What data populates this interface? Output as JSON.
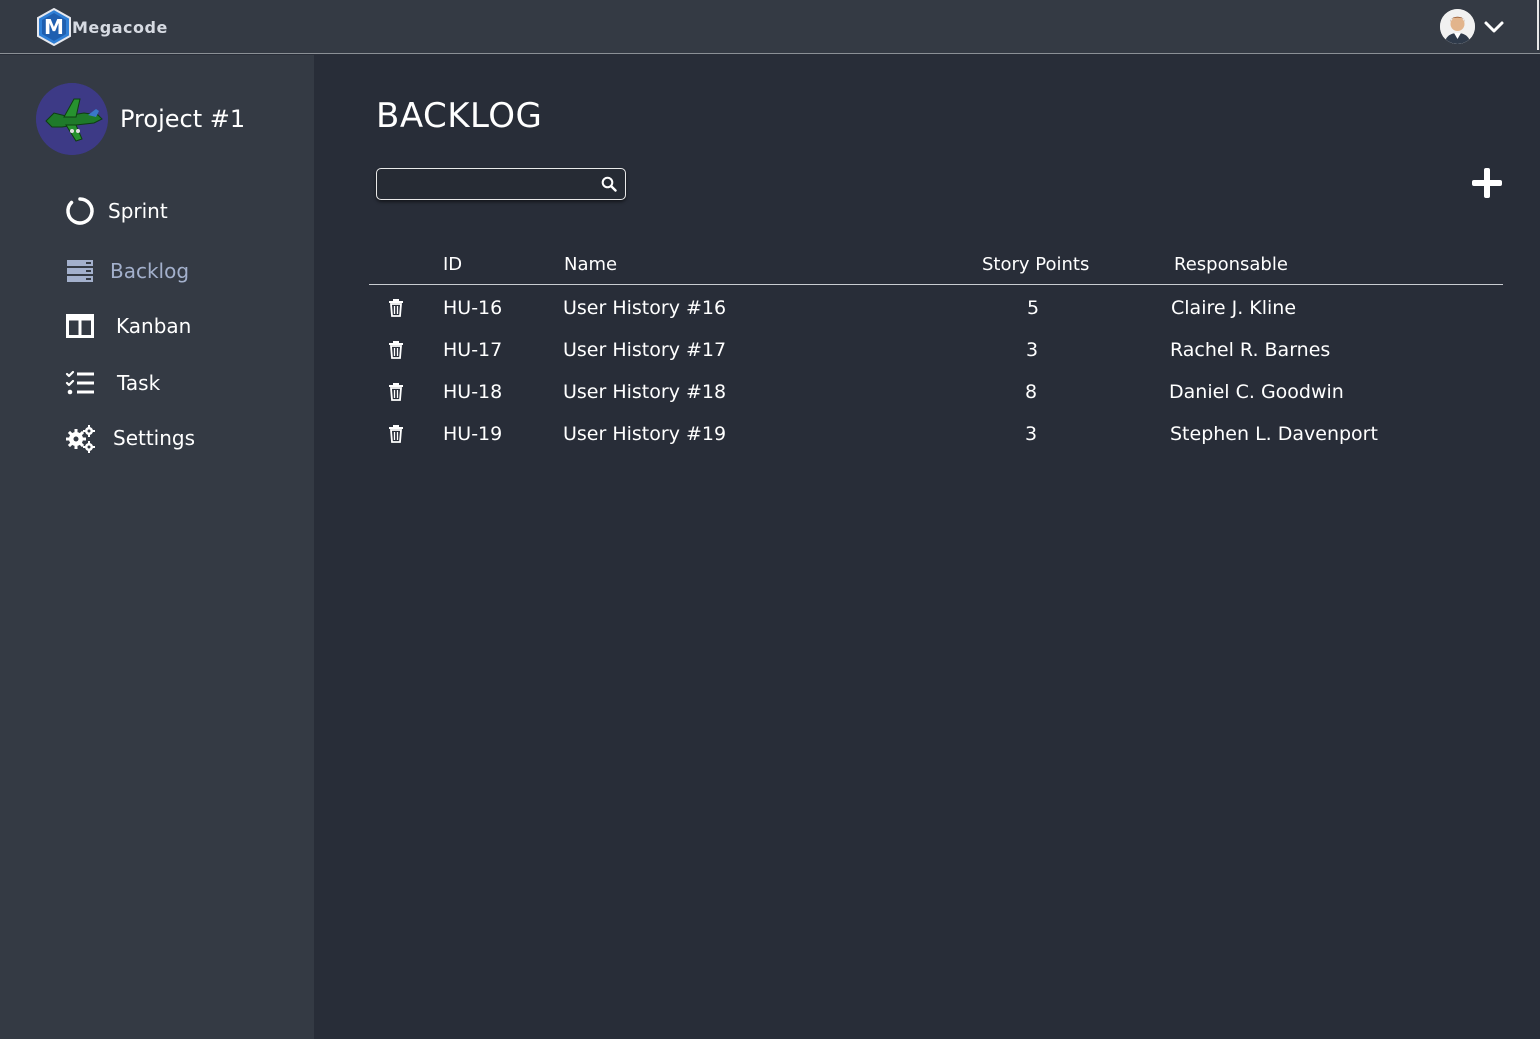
{
  "app": {
    "brand": "Megacode",
    "logo_letter": "M"
  },
  "header": {
    "user_avatar_icon": "user-avatar",
    "menu_icon": "chevron-down-icon"
  },
  "sidebar": {
    "project_title": "Project #1",
    "items": [
      {
        "label": "Sprint",
        "icon": "sprint-circle-icon"
      },
      {
        "label": "Backlog",
        "icon": "backlog-icon",
        "active": true
      },
      {
        "label": "Kanban",
        "icon": "kanban-icon"
      },
      {
        "label": "Task",
        "icon": "task-list-icon"
      },
      {
        "label": "Settings",
        "icon": "gears-icon"
      }
    ]
  },
  "main": {
    "title": "BACKLOG",
    "search": {
      "value": "",
      "placeholder": ""
    },
    "add_icon": "plus-icon",
    "table": {
      "columns": [
        "ID",
        "Name",
        "Story Points",
        "Responsable"
      ],
      "rows": [
        {
          "id": "HU-16",
          "name": "User History #16",
          "points": "5",
          "responsable": "Claire J. Kline"
        },
        {
          "id": "HU-17",
          "name": "User History #17",
          "points": "3",
          "responsable": "Rachel R. Barnes"
        },
        {
          "id": "HU-18",
          "name": "User History #18",
          "points": "8",
          "responsable": "Daniel C. Goodwin"
        },
        {
          "id": "HU-19",
          "name": "User History #19",
          "points": "3",
          "responsable": "Stephen L. Davenport"
        }
      ]
    }
  },
  "colors": {
    "background": "#282d38",
    "sidebar": "#343a44",
    "active_nav": "#a3b0cc"
  }
}
